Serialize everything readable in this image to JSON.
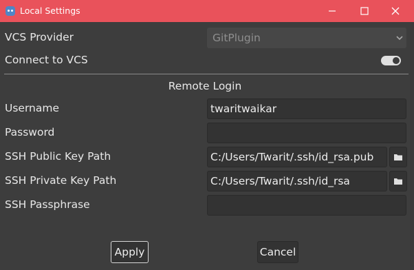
{
  "window": {
    "title": "Local Settings",
    "minimize_icon": "minimize-icon",
    "maximize_icon": "maximize-icon",
    "close_icon": "close-icon"
  },
  "vcs_provider": {
    "label": "VCS Provider",
    "value": "GitPlugin"
  },
  "connect": {
    "label": "Connect to VCS",
    "enabled": true
  },
  "remote_login": {
    "title": "Remote Login",
    "username": {
      "label": "Username",
      "value": "twaritwaikar"
    },
    "password": {
      "label": "Password",
      "value": ""
    },
    "ssh_public_key": {
      "label": "SSH Public Key Path",
      "value": "C:/Users/Twarit/.ssh/id_rsa.pub"
    },
    "ssh_private_key": {
      "label": "SSH Private Key Path",
      "value": "C:/Users/Twarit/.ssh/id_rsa"
    },
    "ssh_passphrase": {
      "label": "SSH Passphrase",
      "value": ""
    }
  },
  "buttons": {
    "apply": "Apply",
    "cancel": "Cancel"
  },
  "colors": {
    "titlebar": "#e9525b",
    "background": "#3d3d3d",
    "field": "#333333"
  }
}
